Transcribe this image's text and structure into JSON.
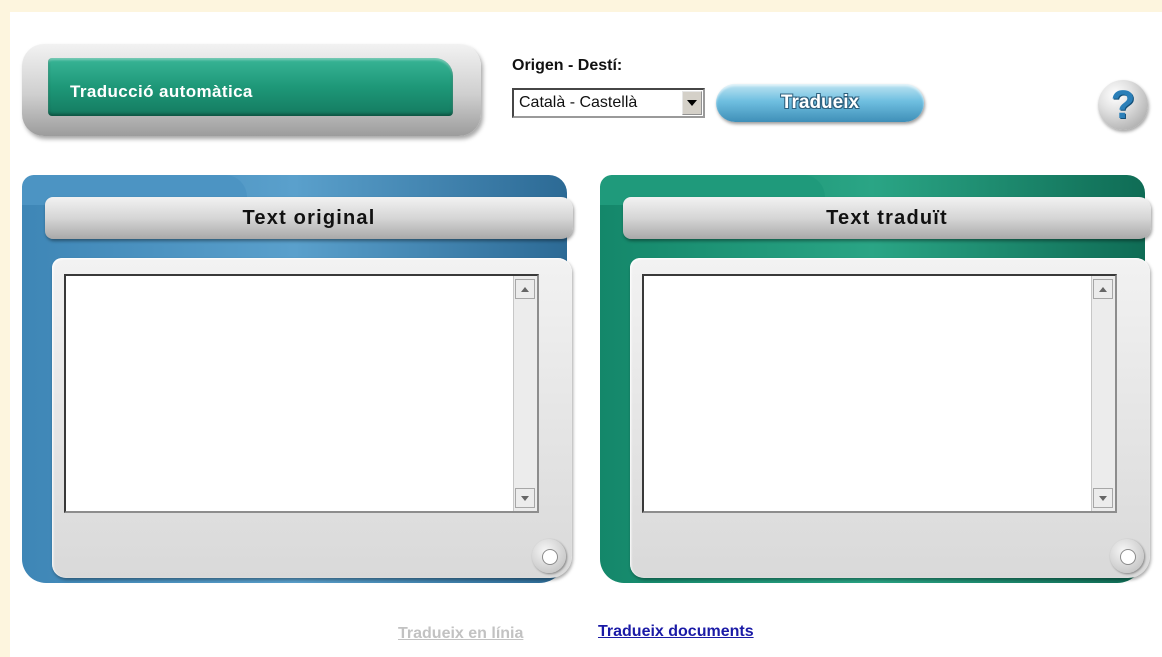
{
  "header": {
    "badge_title": "Traducció automàtica",
    "language_label": "Origen - Destí:",
    "language_select": {
      "selected": "Català - Castellà"
    },
    "translate_button": "Tradueix",
    "help_icon": "?"
  },
  "panels": {
    "original": {
      "title": "Text original",
      "value": ""
    },
    "translated": {
      "title": "Text traduït",
      "value": ""
    }
  },
  "footer": {
    "links": [
      {
        "label": "Tradueix en línia",
        "active": false
      },
      {
        "label": "Tradueix documents",
        "active": true
      }
    ]
  },
  "colors": {
    "accent_green": "#1e9878",
    "accent_blue": "#3e86b6",
    "link": "#1a1aa6",
    "link_disabled": "#c2c2c2",
    "background_frame": "#fdf5de"
  }
}
